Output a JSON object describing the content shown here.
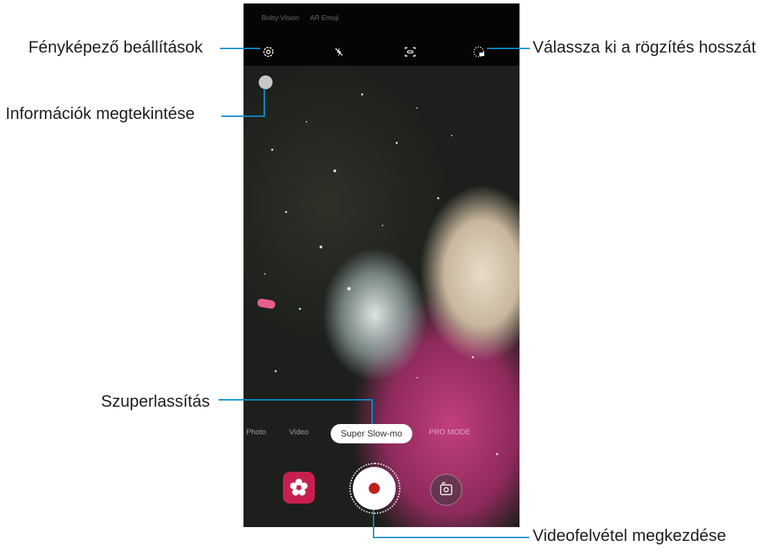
{
  "callouts": {
    "camera_settings": "Fényképező beállítások",
    "view_info": "Információk megtekintése",
    "recording_length": "Válassza ki a rögzítés hosszát",
    "super_slow": "Szuperlassítás",
    "start_recording": "Videofelvétel megkezdése"
  },
  "screen": {
    "top_modes": [
      "Bixby Vision",
      "AR Emoji"
    ],
    "bottom_modes": [
      "Photo",
      "Video",
      "Super Slow-mo",
      "PRO MODE"
    ],
    "selected_mode": "Super Slow-mo"
  },
  "icons": {
    "settings": "gear-icon",
    "flash": "flash-off-icon",
    "motion_detect": "motion-detection-icon",
    "duration": "recording-duration-icon",
    "gallery": "gallery-flower-icon",
    "record": "record-icon",
    "switch_camera": "switch-camera-icon"
  },
  "colors": {
    "callout_line": "#0a8fcd",
    "record_dot": "#c0211a",
    "gallery_tile": "#c8204e"
  }
}
